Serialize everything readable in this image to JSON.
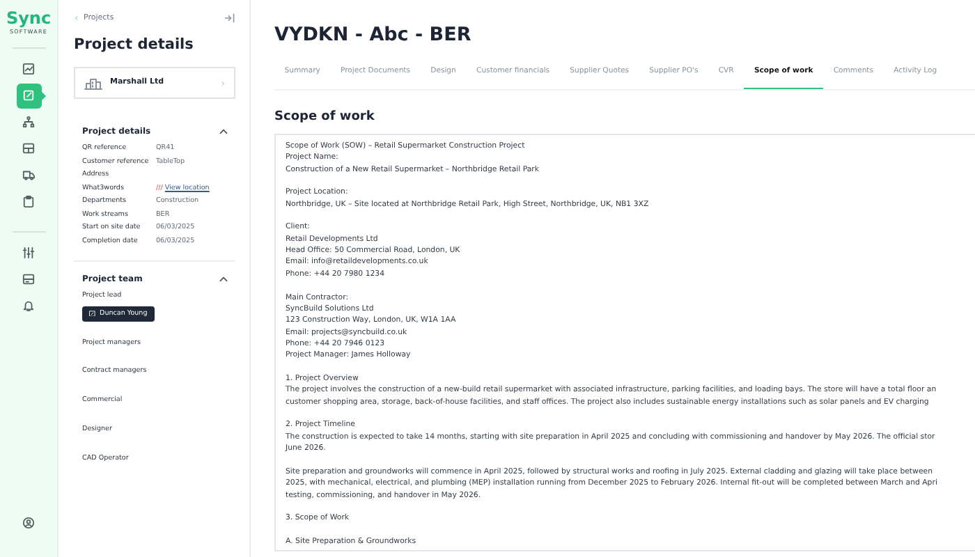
{
  "brand": {
    "name": "Sync",
    "tagline": "SOFTWARE"
  },
  "rail": {
    "items": [
      {
        "selected": false
      },
      {
        "selected": true
      },
      {
        "selected": false
      },
      {
        "selected": false
      },
      {
        "selected": false
      },
      {
        "selected": false
      }
    ],
    "tools": [
      {
        "selected": false
      },
      {
        "selected": false
      },
      {
        "selected": false
      }
    ]
  },
  "panel": {
    "back_link": "Projects",
    "title": "Project details",
    "client": "Marshall Ltd",
    "details": {
      "heading": "Project details",
      "expanded": true,
      "rows": [
        {
          "label": "QR reference",
          "value": "QR41"
        },
        {
          "label": "Customer reference",
          "value": "TableTop"
        },
        {
          "label": "Address"
        },
        {
          "label": "What3words",
          "prefix": "///",
          "value": "View location"
        },
        {
          "label": "Departments",
          "value": "Construction"
        },
        {
          "label": "Work streams",
          "value": "BER"
        },
        {
          "label": "Start on site date",
          "value": "06/03/2025"
        },
        {
          "label": "Completion date",
          "value": "06/03/2025"
        }
      ]
    },
    "team": {
      "heading": "Project team",
      "expanded": true,
      "roles": [
        {
          "role": "Project lead",
          "members": [
            "Duncan Young"
          ]
        },
        {
          "role": "Project managers"
        },
        {
          "role": "Contract managers"
        },
        {
          "role": "Commercial"
        },
        {
          "role": "Designer"
        },
        {
          "role": "CAD Operator"
        }
      ]
    }
  },
  "main": {
    "title": "VYDKN - Abc - BER",
    "tabs": [
      {
        "label": "Summary",
        "selected": false
      },
      {
        "label": "Project Documents",
        "selected": false
      },
      {
        "label": "Design",
        "selected": false
      },
      {
        "label": "Customer financials",
        "selected": false
      },
      {
        "label": "Supplier Quotes",
        "selected": false
      },
      {
        "label": "Supplier PO's",
        "selected": false
      },
      {
        "label": "CVR",
        "selected": false
      },
      {
        "label": "Scope of work",
        "selected": true
      },
      {
        "label": "Comments",
        "selected": false
      },
      {
        "label": "Activity Log",
        "selected": false
      }
    ],
    "section_title": "Scope of work",
    "document": {
      "paragraphs": [
        [
          "Scope of Work (SOW) – Retail Supermarket Construction Project",
          "Project Name:",
          "Construction of a New Retail Supermarket – Northbridge Retail Park"
        ],
        [
          "Project Location:",
          "Northbridge, UK – Site located at Northbridge Retail Park, High Street, Northbridge, UK, NB1 3XZ"
        ],
        [
          "Client:",
          "Retail Developments Ltd",
          "Head Office: 50 Commercial Road, London, UK",
          "Email: info@retaildevelopments.co.uk",
          "Phone: +44 20 7980 1234"
        ],
        [
          "Main Contractor:",
          "SyncBuild Solutions Ltd",
          "123 Construction Way, London, UK, W1A 1AA",
          "Email: projects@syncbuild.co.uk",
          "Phone: +44 20 7946 0123",
          "Project Manager: James Holloway"
        ],
        [
          "1. Project Overview",
          "The project involves the construction of a new-build retail supermarket with associated infrastructure, parking facilities, and loading bays. The store will have a total floor an",
          "customer shopping area, storage, back-of-house facilities, and staff offices. The project also includes sustainable energy installations such as solar panels and EV charging"
        ],
        [
          "2. Project Timeline",
          "The construction is expected to take 14 months, starting with site preparation in April 2025 and concluding with commissioning and handover by May 2026. The official stor",
          "June 2026."
        ],
        [
          "Site preparation and groundworks will commence in April 2025, followed by structural works and roofing in July 2025. External cladding and glazing will take place between",
          "2025, with mechanical, electrical, and plumbing (MEP) installation running from December 2025 to February 2026. Internal fit-out will be completed between March and Apri",
          "testing, commissioning, and handover in May 2026."
        ],
        [
          "3. Scope of Work"
        ],
        [
          "A. Site Preparation & Groundworks"
        ]
      ]
    }
  }
}
